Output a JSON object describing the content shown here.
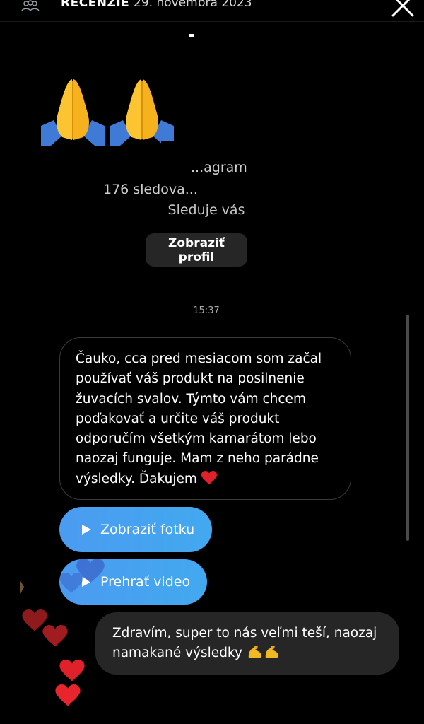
{
  "header": {
    "title": "RECENZIE",
    "date": "29. novembra 2023"
  },
  "profile": {
    "sub_line_1": "...agram",
    "sub_line_2": "176 sledova...",
    "follow_status": "Sleduje vás",
    "view_profile_label": "Zobraziť profil"
  },
  "chat": {
    "timestamp": "15:37",
    "incoming_message": "Čauko, cca pred mesiacom som začal používať váš produkt na posilnenie žuvacích svalov. Týmto vám chcem poďakovať a určite váš produkt odporučím všetkým kamarátom lebo naozaj funguje. Mam z neho parádne výsledky. Ďakujem",
    "view_photo_label": "Zobraziť fotku",
    "play_video_label": "Prehrať video",
    "outgoing_message": "Zdravím, super to nás veľmi teší, naozaj namakané výsledky"
  },
  "colors": {
    "accent_blue": "#4b9bf0",
    "bubble_dark": "#262626",
    "heart_red": "#e0202a"
  },
  "icons": [
    "group-icon",
    "close-icon",
    "pray-emoji",
    "heart-emoji",
    "play-icon",
    "muscle-emoji",
    "floating-heart"
  ]
}
